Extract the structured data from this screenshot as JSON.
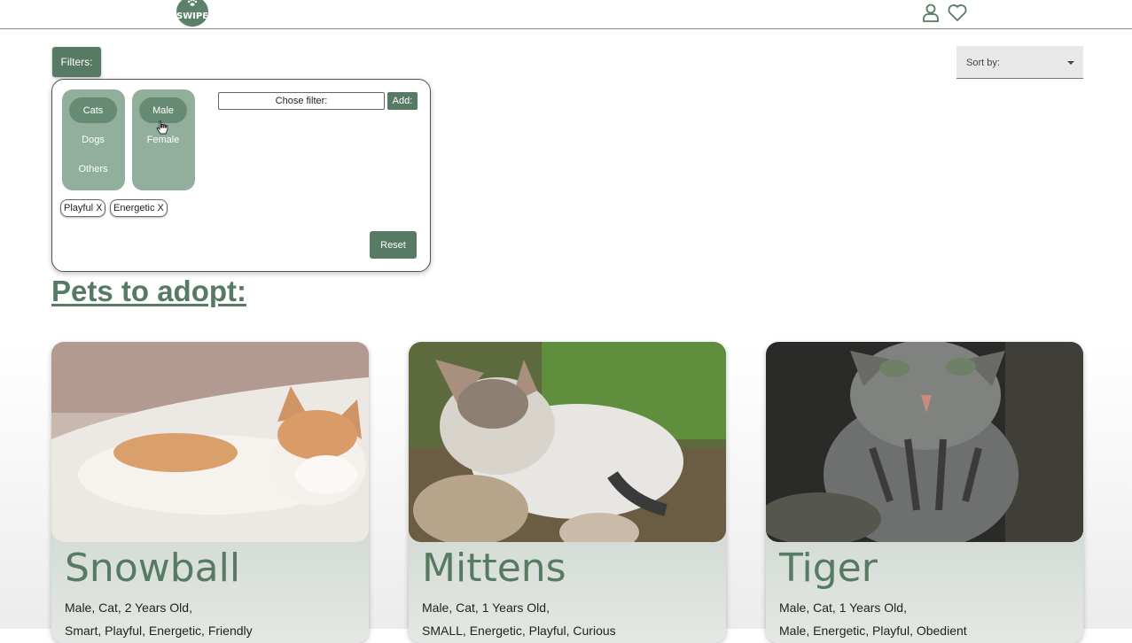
{
  "header": {
    "logo_text": "SWIPE"
  },
  "filters": {
    "button_label": "Filters:",
    "species": [
      "Cats",
      "Dogs",
      "Others"
    ],
    "gender": [
      "Male",
      "Female"
    ],
    "chose_filter_label": "Chose filter:",
    "add_label": "Add:",
    "tags": [
      "Playful X",
      "Energetic X"
    ],
    "reset_label": "Reset"
  },
  "sort": {
    "label": "Sort by:"
  },
  "heading": "Pets to adopt:",
  "pets": [
    {
      "name": "Snowball",
      "line1": "Male, Cat, 2 Years Old,",
      "line2": "Smart, Playful, Energetic, Friendly"
    },
    {
      "name": "Mittens",
      "line1": "Male, Cat, 1 Years Old,",
      "line2": "SMALL, Energetic, Playful, Curious"
    },
    {
      "name": "Tiger",
      "line1": "Male, Cat, 1 Years Old,",
      "line2": "Male, Energetic, Playful, Obedient"
    }
  ],
  "colors": {
    "accent": "#567a63",
    "panel_group": "#92ae9c"
  }
}
